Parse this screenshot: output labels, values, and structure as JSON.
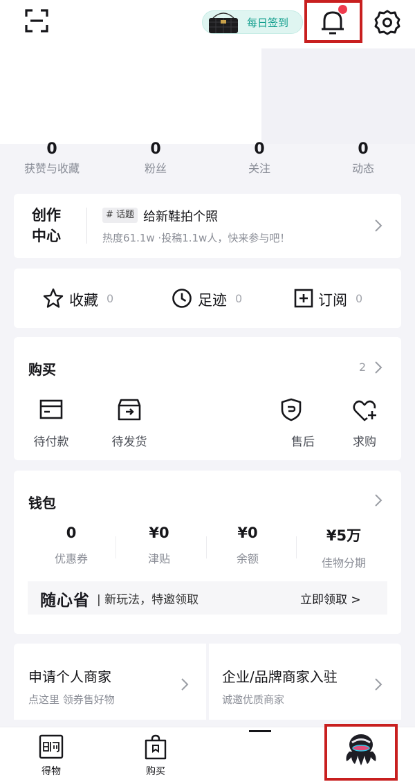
{
  "header": {
    "checkin_label": "每日签到",
    "icons": [
      "scan-icon",
      "bell-icon",
      "gear-icon"
    ],
    "notification_dot_color": "#ef3b4e",
    "highlight_color": "#c81f1f"
  },
  "stats": [
    {
      "value": "0",
      "label": "获赞与收藏"
    },
    {
      "value": "0",
      "label": "粉丝"
    },
    {
      "value": "0",
      "label": "关注"
    },
    {
      "value": "0",
      "label": "动态"
    }
  ],
  "creator": {
    "title_line1": "创作",
    "title_line2": "中心",
    "tag": "# 话题",
    "topic": "给新鞋拍个照",
    "subtitle": "热度61.1w ·投稿1.1w人，快来参与吧！"
  },
  "quick_links": [
    {
      "label": "收藏",
      "count": "0",
      "icon": "star-icon"
    },
    {
      "label": "足迹",
      "count": "0",
      "icon": "clock-icon"
    },
    {
      "label": "订阅",
      "count": "0",
      "icon": "plus-square-icon"
    }
  ],
  "purchase": {
    "title": "购买",
    "count": "2",
    "items": [
      {
        "label": "待付款",
        "icon": "card-icon"
      },
      {
        "label": "待发货",
        "icon": "box-icon"
      },
      {
        "label": "",
        "icon": ""
      },
      {
        "label": "售后",
        "icon": "shield-icon"
      },
      {
        "label": "求购",
        "icon": "heart-plus-icon"
      }
    ]
  },
  "wallet": {
    "title": "钱包",
    "items": [
      {
        "value": "0",
        "label": "优惠券"
      },
      {
        "value": "¥0",
        "label": "津贴"
      },
      {
        "value": "¥0",
        "label": "余额"
      },
      {
        "value": "¥5万",
        "label": "佳物分期"
      }
    ],
    "promo_logo": "随心省",
    "promo_text": "| 新玩法，特邀领取",
    "promo_action": "立即领取 >"
  },
  "merchants": [
    {
      "title": "申请个人商家",
      "subtitle": "点这里 领券售好物"
    },
    {
      "title": "企业/品牌商家入驻",
      "subtitle": "诚邀优质商家"
    }
  ],
  "bottom_nav": [
    {
      "label": "得物",
      "icon": "dewu-logo-icon"
    },
    {
      "label": "购买",
      "icon": "shopping-bag-icon"
    },
    {
      "label": "",
      "icon": "avatar-icon"
    }
  ],
  "colors": {
    "accent_teal": "#0f9d8c",
    "background": "#f4f4f8"
  }
}
